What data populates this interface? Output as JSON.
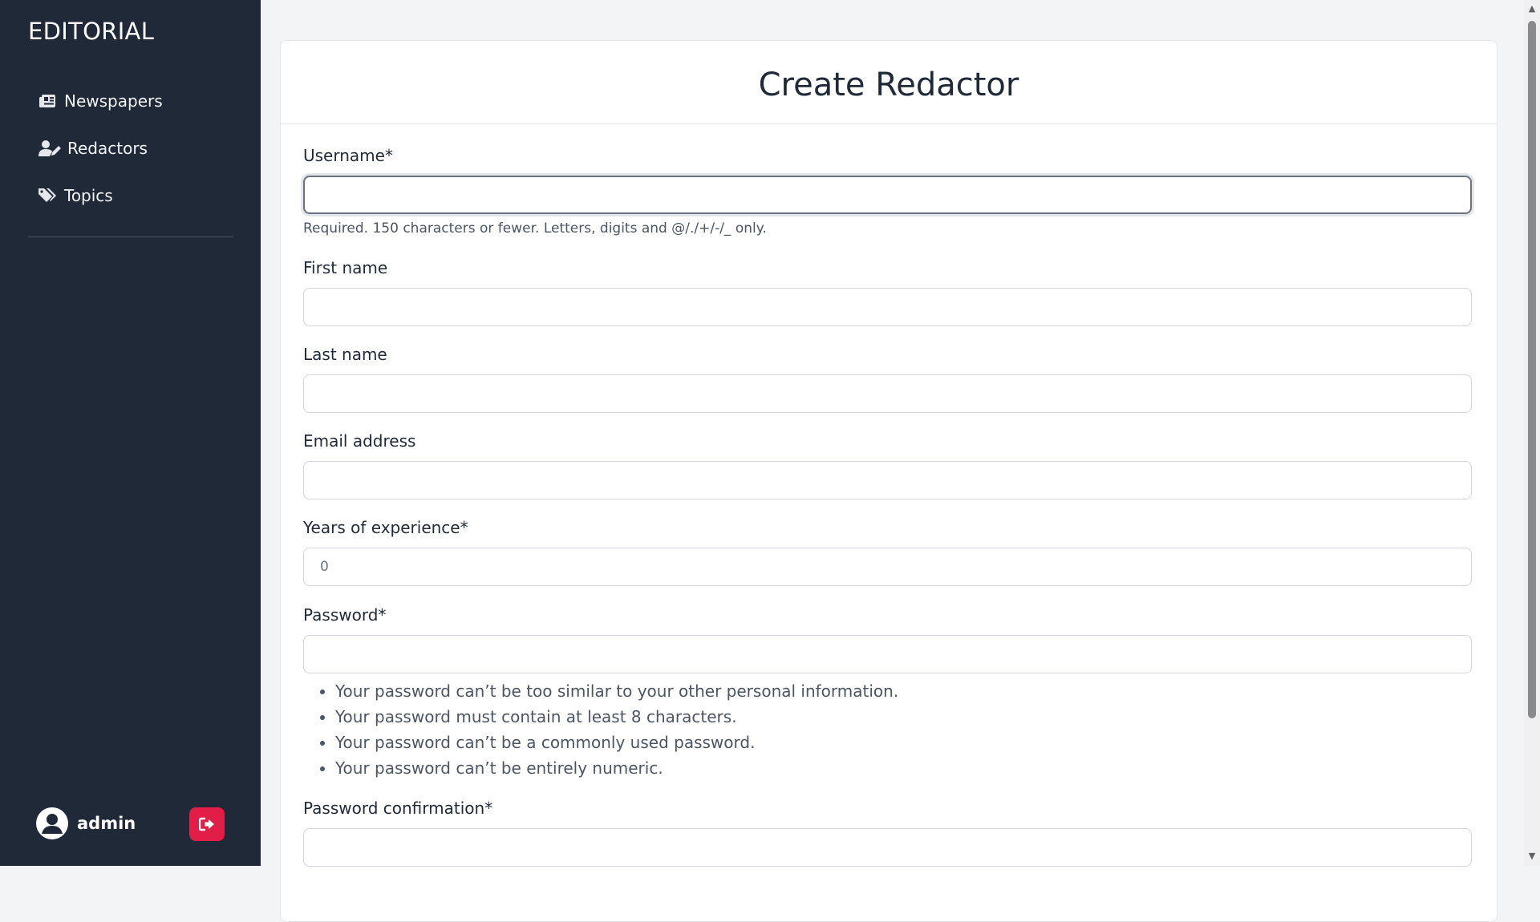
{
  "sidebar": {
    "brand": "EDITORIAL",
    "items": [
      {
        "label": "Newspapers",
        "icon": "newspaper-icon"
      },
      {
        "label": "Redactors",
        "icon": "user-pen-icon"
      },
      {
        "label": "Topics",
        "icon": "tags-icon"
      }
    ],
    "user": {
      "name": "admin",
      "icon": "user-circle-icon"
    },
    "logout_icon": "logout-icon"
  },
  "page": {
    "title": "Create Redactor"
  },
  "form": {
    "username": {
      "label": "Username*",
      "value": "",
      "help": "Required. 150 characters or fewer. Letters, digits and @/./+/-/_ only."
    },
    "first_name": {
      "label": "First name",
      "value": ""
    },
    "last_name": {
      "label": "Last name",
      "value": ""
    },
    "email": {
      "label": "Email address",
      "value": ""
    },
    "years_of_experience": {
      "label": "Years of experience*",
      "placeholder": "0"
    },
    "password": {
      "label": "Password*",
      "value": "",
      "help": [
        "Your password can’t be too similar to your other personal information.",
        "Your password must contain at least 8 characters.",
        "Your password can’t be a commonly used password.",
        "Your password can’t be entirely numeric."
      ]
    },
    "password_confirmation": {
      "label": "Password confirmation*",
      "value": ""
    }
  },
  "colors": {
    "sidebar_bg": "#1f2937",
    "page_bg": "#f3f4f6",
    "logout_bg": "#e11d48"
  }
}
